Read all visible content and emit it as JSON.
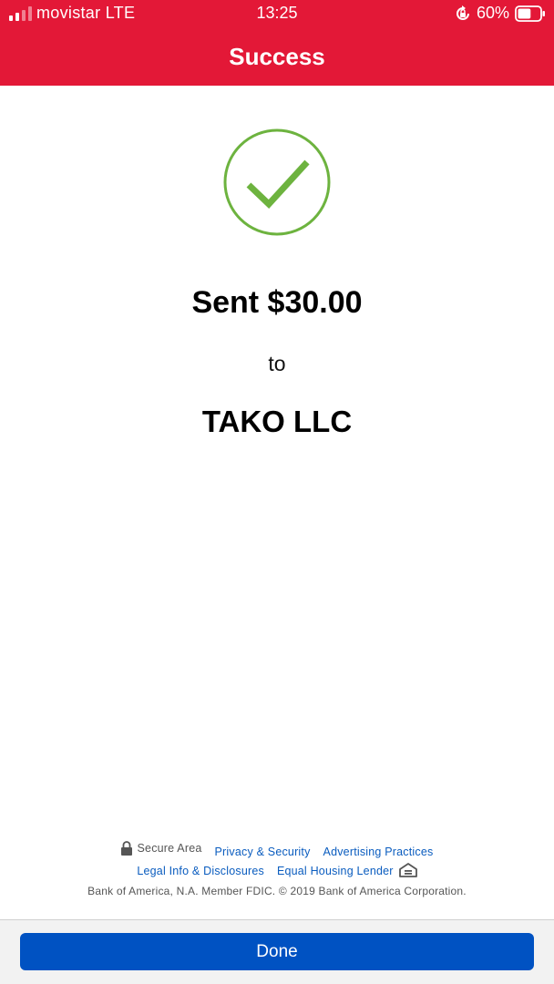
{
  "status_bar": {
    "carrier": "movistar LTE",
    "time": "13:25",
    "battery_percent": "60%",
    "battery_level": 0.6,
    "icons": [
      "signal-icon",
      "rotation-lock-icon",
      "battery-icon"
    ]
  },
  "header": {
    "title": "Success",
    "color": "#e31837"
  },
  "confirmation": {
    "icon": "checkmark-circle-icon",
    "icon_color": "#6db33f",
    "amount_text": "Sent $30.00",
    "to_label": "to",
    "recipient": "TAKO LLC"
  },
  "footer": {
    "secure_area": "Secure Area",
    "privacy_security": "Privacy & Security",
    "advertising_practices": "Advertising Practices",
    "legal_info": "Legal Info & Disclosures",
    "equal_housing": "Equal Housing Lender",
    "copyright": "Bank of America, N.A. Member FDIC. © 2019 Bank of America Corporation.",
    "link_color": "#0a5cbf"
  },
  "actions": {
    "done_label": "Done",
    "button_color": "#0052c2"
  }
}
